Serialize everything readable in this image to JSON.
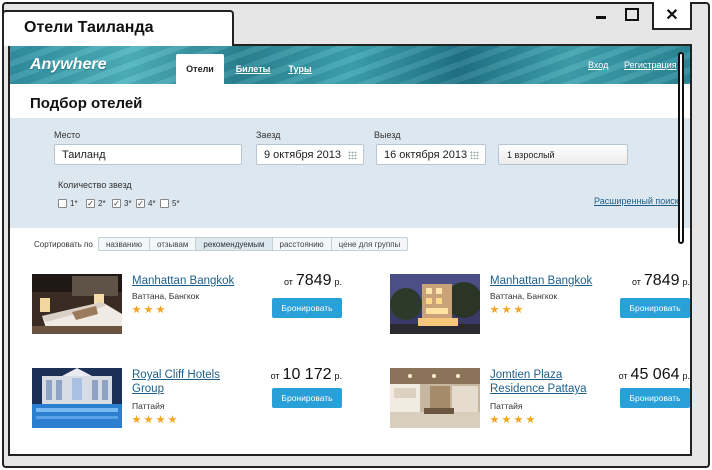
{
  "window": {
    "title": "Отели Таиланда",
    "close_glyph": "✕"
  },
  "header": {
    "logo": "Anywhere",
    "tabs": [
      {
        "label": "Отели",
        "active": true
      },
      {
        "label": "Билеты",
        "active": false
      },
      {
        "label": "Туры",
        "active": false
      }
    ],
    "login": "Вход",
    "register": "Регистрация"
  },
  "page_title": "Подбор отелей",
  "filters": {
    "place_label": "Место",
    "place_value": "Таиланд",
    "checkin_label": "Заезд",
    "checkin_value": "9 октября 2013",
    "checkout_label": "Выезд",
    "checkout_value": "16 октября 2013",
    "guests_value": "1 взрослый",
    "stars_label": "Количество звезд",
    "star_options": [
      {
        "label": "1*",
        "checked": false
      },
      {
        "label": "2*",
        "checked": true
      },
      {
        "label": "3*",
        "checked": true
      },
      {
        "label": "4*",
        "checked": true
      },
      {
        "label": "5*",
        "checked": false
      }
    ],
    "advanced_search": "Расширенный поиск"
  },
  "sort": {
    "label": "Сортировать по",
    "options": [
      "названию",
      "отзывам",
      "рекомендуемым",
      "расстоянию",
      "цене для группы"
    ],
    "active": "рекомендуемым"
  },
  "hotels": [
    {
      "name": "Manhattan Bangkok",
      "location": "Ваттана, Бангкок",
      "stars": 3,
      "price_from": "от",
      "price": "7849",
      "currency": "р.",
      "book": "Бронировать"
    },
    {
      "name": "Manhattan Bangkok",
      "location": "Ваттана, Бангкок",
      "stars": 3,
      "price_from": "от",
      "price": "7849",
      "currency": "р.",
      "book": "Бронировать"
    },
    {
      "name": "Royal Cliff Hotels Group",
      "location": "Паттайя",
      "stars": 4,
      "price_from": "от",
      "price": "10 172",
      "currency": "р.",
      "book": "Бронировать"
    },
    {
      "name": "Jomtien Plaza Residence Pattaya",
      "location": "Паттайя",
      "stars": 4,
      "price_from": "от",
      "price": "45 064",
      "currency": "р.",
      "book": "Бронировать"
    }
  ],
  "colors": {
    "accent": "#2aa0d8",
    "link": "#1d5f8a",
    "star": "#f5a623",
    "filter_bg": "#dde7ef"
  }
}
